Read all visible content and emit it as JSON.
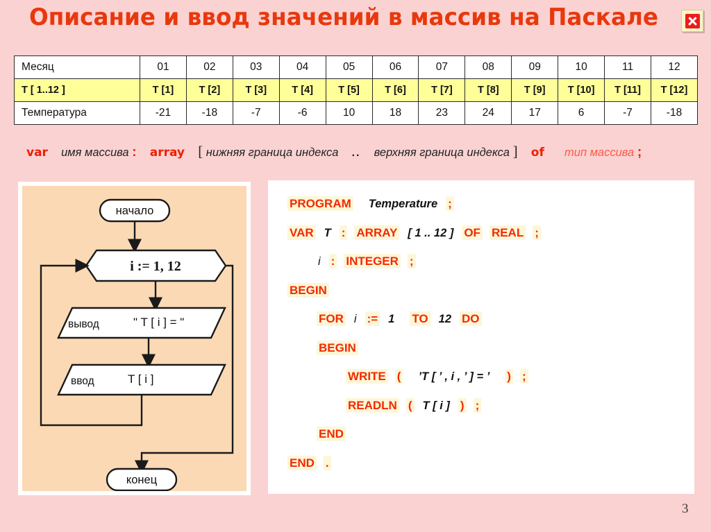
{
  "slide": {
    "title": "Описание и ввод значений в массив на Паскале",
    "page_number": "3",
    "close_icon": "close-icon",
    "accent_color": "#e8380d",
    "background_color": "#fbd2d2",
    "highlight_row_color": "#ffff99",
    "flow_panel_color": "#fbd9b4",
    "code_panel_color": "#ffffff"
  },
  "table": {
    "rows": [
      {
        "header": "Месяц",
        "cells": [
          "01",
          "02",
          "03",
          "04",
          "05",
          "06",
          "07",
          "08",
          "09",
          "10",
          "11",
          "12"
        ]
      },
      {
        "header": "T [ 1..12 ]",
        "cells": [
          "T [1]",
          "T [2]",
          "T [3]",
          "T [4]",
          "T [5]",
          "T [6]",
          "T [7]",
          "T [8]",
          "T [9]",
          "T [10]",
          "T [11]",
          "T [12]"
        ]
      },
      {
        "header": "Температура",
        "cells": [
          "-21",
          "-18",
          "-7",
          "-6",
          "10",
          "18",
          "23",
          "24",
          "17",
          "6",
          "-7",
          "-18"
        ]
      }
    ]
  },
  "syntax_line": {
    "kw_var": "var",
    "array_name": "имя массива",
    "colon": ":",
    "kw_array": "array",
    "bracket_open": "[",
    "lower_bound": "нижняя граница индекса",
    "range_dots": "..",
    "upper_bound": "верхняя граница индекса",
    "bracket_close": "]",
    "kw_of": "of",
    "array_type": "тип массива",
    "semicolon": ";"
  },
  "flowchart": {
    "start": "начало",
    "loop": "i := 1, 12",
    "output": "вывод",
    "output_value": "\" T [ i ] = \"",
    "input": "ввод",
    "input_value": "T [ i ]",
    "end": "конец"
  },
  "code": {
    "lines": [
      {
        "indent": 0,
        "tokens": [
          {
            "t": "k",
            "v": "PROGRAM"
          },
          {
            "t": "sp2"
          },
          {
            "t": "id",
            "v": "Temperature"
          },
          {
            "t": "sp"
          },
          {
            "t": "k",
            "v": ";"
          }
        ]
      },
      {
        "indent": 0,
        "tokens": [
          {
            "t": "k",
            "v": "VAR"
          },
          {
            "t": "sp"
          },
          {
            "t": "id",
            "v": "T"
          },
          {
            "t": "sp"
          },
          {
            "t": "k",
            "v": ":"
          },
          {
            "t": "sp"
          },
          {
            "t": "k",
            "v": "ARRAY"
          },
          {
            "t": "sp"
          },
          {
            "t": "id",
            "v": "[ 1 .. 12 ]"
          },
          {
            "t": "sp"
          },
          {
            "t": "k",
            "v": "OF"
          },
          {
            "t": "sp"
          },
          {
            "t": "k",
            "v": "REAL"
          },
          {
            "t": "sp"
          },
          {
            "t": "k",
            "v": ";"
          }
        ]
      },
      {
        "indent": 1,
        "tokens": [
          {
            "t": "idp",
            "v": "i"
          },
          {
            "t": "sp"
          },
          {
            "t": "k",
            "v": ":"
          },
          {
            "t": "sp"
          },
          {
            "t": "k",
            "v": "INTEGER"
          },
          {
            "t": "sp"
          },
          {
            "t": "k",
            "v": ";"
          }
        ]
      },
      {
        "indent": 0,
        "tokens": [
          {
            "t": "k",
            "v": "BEGIN"
          }
        ]
      },
      {
        "indent": 1,
        "tokens": [
          {
            "t": "k",
            "v": "FOR"
          },
          {
            "t": "sp"
          },
          {
            "t": "idp",
            "v": "i"
          },
          {
            "t": "sp"
          },
          {
            "t": "k",
            "v": ":="
          },
          {
            "t": "sp"
          },
          {
            "t": "id",
            "v": "1"
          },
          {
            "t": "sp2"
          },
          {
            "t": "k",
            "v": "TO"
          },
          {
            "t": "sp"
          },
          {
            "t": "id",
            "v": "12"
          },
          {
            "t": "sp"
          },
          {
            "t": "k",
            "v": "DO"
          }
        ]
      },
      {
        "indent": 1,
        "tokens": [
          {
            "t": "k",
            "v": "BEGIN"
          }
        ]
      },
      {
        "indent": 2,
        "tokens": [
          {
            "t": "k",
            "v": "WRITE"
          },
          {
            "t": "sp"
          },
          {
            "t": "k",
            "v": "("
          },
          {
            "t": "sp2"
          },
          {
            "t": "id",
            "v": "’T [ ’ ,  i ,  ’ ] = ’"
          },
          {
            "t": "sp2"
          },
          {
            "t": "k",
            "v": ")"
          },
          {
            "t": "sp"
          },
          {
            "t": "k",
            "v": ";"
          }
        ]
      },
      {
        "indent": 2,
        "tokens": [
          {
            "t": "k",
            "v": "READLN"
          },
          {
            "t": "sp"
          },
          {
            "t": "k",
            "v": "("
          },
          {
            "t": "sp"
          },
          {
            "t": "id",
            "v": "T [ i ]"
          },
          {
            "t": "sp"
          },
          {
            "t": "k",
            "v": ")"
          },
          {
            "t": "sp"
          },
          {
            "t": "k",
            "v": ";"
          }
        ]
      },
      {
        "indent": 1,
        "tokens": [
          {
            "t": "k",
            "v": "END"
          }
        ]
      },
      {
        "indent": 0,
        "tokens": [
          {
            "t": "k",
            "v": "END"
          },
          {
            "t": "sp"
          },
          {
            "t": "k",
            "v": "."
          }
        ]
      }
    ]
  }
}
